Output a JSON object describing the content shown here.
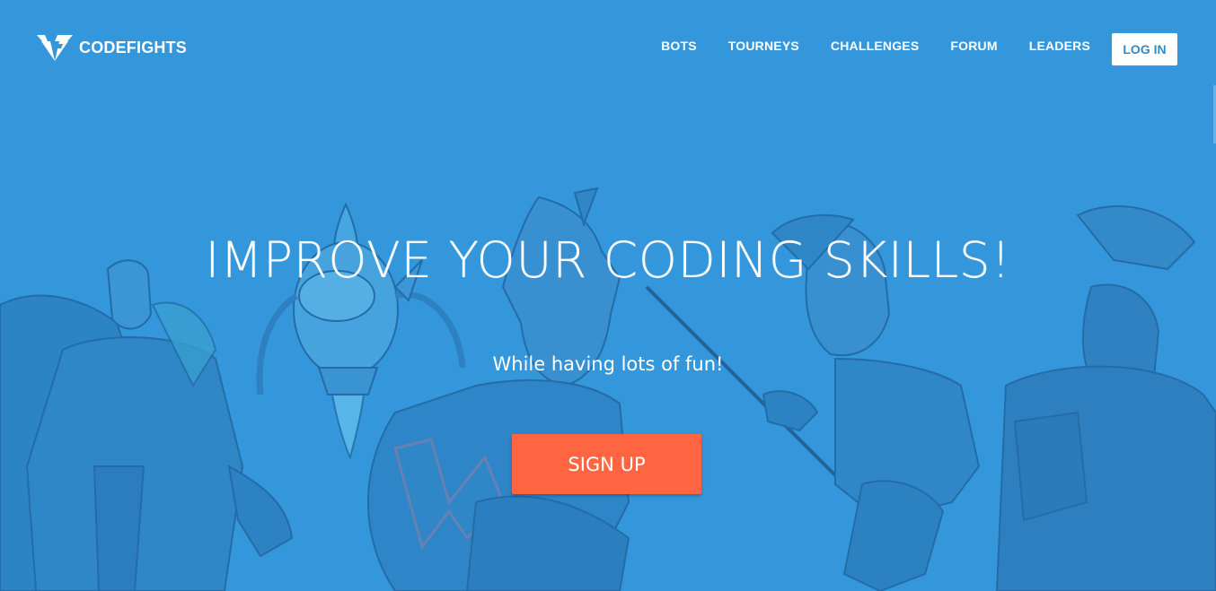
{
  "brand": {
    "name": "CODEFIGHTS",
    "logo_icon": "codefights-logo-icon"
  },
  "nav": {
    "items": [
      {
        "label": "BOTS"
      },
      {
        "label": "TOURNEYS"
      },
      {
        "label": "CHALLENGES"
      },
      {
        "label": "FORUM"
      },
      {
        "label": "LEADERS"
      }
    ],
    "login_label": "LOG IN"
  },
  "hero": {
    "title": "IMPROVE YOUR CODING SKILLS!",
    "subtitle": "While having lots of fun!",
    "cta_label": "SIGN UP"
  },
  "colors": {
    "background": "#3597db",
    "cta": "#ff6541",
    "login_text": "#2f8bd0",
    "art_dark": "#2b7fbf",
    "art_mid": "#3a8ecd",
    "art_line": "#1f5f96"
  }
}
